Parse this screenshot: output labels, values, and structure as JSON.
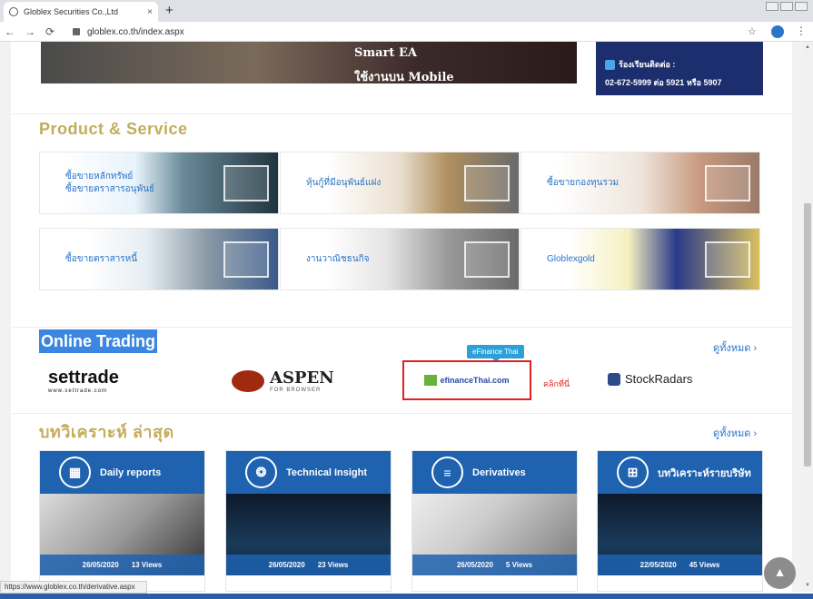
{
  "browser": {
    "tab_title": "Globlex Securities Co.,Ltd",
    "tab_close": "×",
    "new_tab": "+",
    "back": "←",
    "forward": "→",
    "reload": "⟳",
    "url": "globlex.co.th/index.aspx",
    "bookmark_star": "☆",
    "menu": "⋮"
  },
  "banner": {
    "line1": "Smart EA",
    "line2": "ใช้งานบน Mobile"
  },
  "contact": {
    "phone_top": "02-672-5999",
    "label": "ร้องเรียนติดต่อ :",
    "phone": "02-672-5999 ต่อ 5921 หรือ 5907"
  },
  "products": {
    "title": "Product & Service",
    "tiles": [
      {
        "label": "ซื้อขายหลักทรัพย์\nซื้อขายตราสารอนุพันธ์"
      },
      {
        "label": "หุ้นกู้ที่มีอนุพันธ์แฝง"
      },
      {
        "label": "ซื้อขายกองทุนรวม"
      },
      {
        "label": "ซื้อขายตราสารหนี้"
      },
      {
        "label": "งานวาณิชธนกิจ"
      },
      {
        "label": "Globlexgold"
      }
    ]
  },
  "online_trading": {
    "title": "Online Trading",
    "see_all": "ดูทั้งหมด ›",
    "settrade": "settrade",
    "settrade_sub": "www.settrade.com",
    "aspen": "ASPEN",
    "aspen_sub": "FOR BROWSER",
    "tooltip": "eFinance Thai",
    "efinance": "efinanceThai.com",
    "click_here": "คลิกที่นี่",
    "stockradars": "StockRadars"
  },
  "analysis": {
    "title": "บทวิเคราะห์ ล่าสุด",
    "see_all": "ดูทั้งหมด ›",
    "cards": [
      {
        "title": "Daily reports",
        "date": "26/05/2020",
        "views": "13 Views"
      },
      {
        "title": "Technical Insight",
        "date": "26/05/2020",
        "views": "23 Views"
      },
      {
        "title": "Derivatives",
        "date": "26/05/2020",
        "views": "5 Views"
      },
      {
        "title": "บทวิเคราะห์รายบริษัท",
        "date": "22/05/2020",
        "views": "45 Views"
      }
    ]
  },
  "status_url": "https://www.globlex.co.th/derivative.aspx",
  "colors": {
    "accent": "#1e62b0",
    "gold": "#c3ad5a",
    "red": "#e02020"
  }
}
